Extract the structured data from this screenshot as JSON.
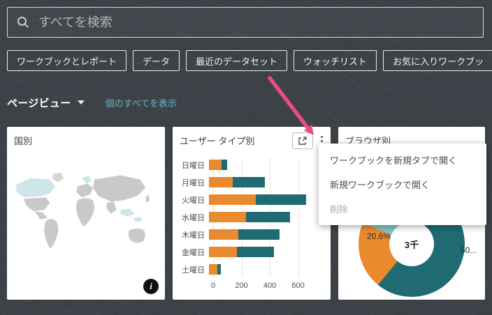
{
  "search": {
    "placeholder": "すべてを検索"
  },
  "filter_chips": [
    {
      "label": "ワークブックとレポート"
    },
    {
      "label": "データ"
    },
    {
      "label": "最近のデータセット"
    },
    {
      "label": "ウォッチリスト"
    },
    {
      "label": "お気に入りワークブッ"
    }
  ],
  "section": {
    "title": "ページビュー",
    "show_all_link": "個のすべてを表示"
  },
  "cards": {
    "country": {
      "title": "国別"
    },
    "user_type": {
      "title": "ユーザー タイプ別"
    },
    "browser": {
      "title": "ブラウザ別"
    }
  },
  "context_menu": {
    "items": [
      {
        "label": "ワークブックを新規タブで開く",
        "disabled": false
      },
      {
        "label": "新規ワークブックで開く",
        "disabled": false
      },
      {
        "label": "削除",
        "disabled": true
      }
    ]
  },
  "icons": {
    "search": "magnifier-icon",
    "open_in_new": "open-in-new-tab-icon",
    "kebab": "vertical-ellipsis-icon",
    "info": "info-icon",
    "caret": "caret-down-icon"
  },
  "colors": {
    "background": "#3d4248",
    "card": "#ffffff",
    "chip_border": "#ececec",
    "link": "#6ab3c2",
    "orange": "#ea8a2e",
    "teal": "#206a73",
    "light_teal": "#7fc6c6",
    "annotation_arrow": "#ec4b81"
  },
  "chart_data": [
    {
      "type": "map",
      "title": "国別",
      "land_color": "#c9c9c9",
      "highlight_color": "#cfe6e8",
      "legend": "none"
    },
    {
      "type": "bar",
      "orientation": "horizontal",
      "title": "ユーザー タイプ別",
      "categories": [
        "日曜日",
        "月曜日",
        "火曜日",
        "水曜日",
        "木曜日",
        "金曜日",
        "土曜日"
      ],
      "series": [
        {
          "name": "orange",
          "color": "#ea8a2e",
          "values": [
            85,
            160,
            320,
            250,
            200,
            190,
            55
          ]
        },
        {
          "name": "teal",
          "color": "#206a73",
          "values": [
            40,
            220,
            340,
            300,
            280,
            250,
            25
          ]
        }
      ],
      "xticks": [
        0,
        200,
        400,
        600
      ],
      "xlim": [
        0,
        780
      ],
      "grid": true,
      "legend": "none"
    },
    {
      "type": "pie",
      "donut": true,
      "title": "ブラウザ別",
      "center_label": "3千",
      "slices": [
        {
          "label": "60...",
          "value": 60.9,
          "color": "#206a73"
        },
        {
          "label": "20.6%",
          "value": 20.6,
          "color": "#ea8a2e"
        },
        {
          "label": "",
          "value": 18.5,
          "color": "#7fc6c6"
        }
      ],
      "legend": "none"
    }
  ]
}
